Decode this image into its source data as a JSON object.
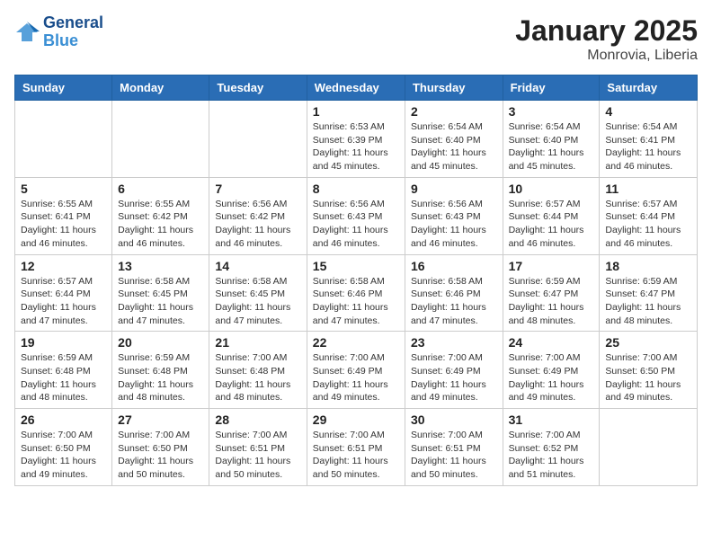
{
  "header": {
    "logo_line1": "General",
    "logo_line2": "Blue",
    "month": "January 2025",
    "location": "Monrovia, Liberia"
  },
  "days_of_week": [
    "Sunday",
    "Monday",
    "Tuesday",
    "Wednesday",
    "Thursday",
    "Friday",
    "Saturday"
  ],
  "weeks": [
    [
      {
        "day": "",
        "info": ""
      },
      {
        "day": "",
        "info": ""
      },
      {
        "day": "",
        "info": ""
      },
      {
        "day": "1",
        "info": "Sunrise: 6:53 AM\nSunset: 6:39 PM\nDaylight: 11 hours\nand 45 minutes."
      },
      {
        "day": "2",
        "info": "Sunrise: 6:54 AM\nSunset: 6:40 PM\nDaylight: 11 hours\nand 45 minutes."
      },
      {
        "day": "3",
        "info": "Sunrise: 6:54 AM\nSunset: 6:40 PM\nDaylight: 11 hours\nand 45 minutes."
      },
      {
        "day": "4",
        "info": "Sunrise: 6:54 AM\nSunset: 6:41 PM\nDaylight: 11 hours\nand 46 minutes."
      }
    ],
    [
      {
        "day": "5",
        "info": "Sunrise: 6:55 AM\nSunset: 6:41 PM\nDaylight: 11 hours\nand 46 minutes."
      },
      {
        "day": "6",
        "info": "Sunrise: 6:55 AM\nSunset: 6:42 PM\nDaylight: 11 hours\nand 46 minutes."
      },
      {
        "day": "7",
        "info": "Sunrise: 6:56 AM\nSunset: 6:42 PM\nDaylight: 11 hours\nand 46 minutes."
      },
      {
        "day": "8",
        "info": "Sunrise: 6:56 AM\nSunset: 6:43 PM\nDaylight: 11 hours\nand 46 minutes."
      },
      {
        "day": "9",
        "info": "Sunrise: 6:56 AM\nSunset: 6:43 PM\nDaylight: 11 hours\nand 46 minutes."
      },
      {
        "day": "10",
        "info": "Sunrise: 6:57 AM\nSunset: 6:44 PM\nDaylight: 11 hours\nand 46 minutes."
      },
      {
        "day": "11",
        "info": "Sunrise: 6:57 AM\nSunset: 6:44 PM\nDaylight: 11 hours\nand 46 minutes."
      }
    ],
    [
      {
        "day": "12",
        "info": "Sunrise: 6:57 AM\nSunset: 6:44 PM\nDaylight: 11 hours\nand 47 minutes."
      },
      {
        "day": "13",
        "info": "Sunrise: 6:58 AM\nSunset: 6:45 PM\nDaylight: 11 hours\nand 47 minutes."
      },
      {
        "day": "14",
        "info": "Sunrise: 6:58 AM\nSunset: 6:45 PM\nDaylight: 11 hours\nand 47 minutes."
      },
      {
        "day": "15",
        "info": "Sunrise: 6:58 AM\nSunset: 6:46 PM\nDaylight: 11 hours\nand 47 minutes."
      },
      {
        "day": "16",
        "info": "Sunrise: 6:58 AM\nSunset: 6:46 PM\nDaylight: 11 hours\nand 47 minutes."
      },
      {
        "day": "17",
        "info": "Sunrise: 6:59 AM\nSunset: 6:47 PM\nDaylight: 11 hours\nand 48 minutes."
      },
      {
        "day": "18",
        "info": "Sunrise: 6:59 AM\nSunset: 6:47 PM\nDaylight: 11 hours\nand 48 minutes."
      }
    ],
    [
      {
        "day": "19",
        "info": "Sunrise: 6:59 AM\nSunset: 6:48 PM\nDaylight: 11 hours\nand 48 minutes."
      },
      {
        "day": "20",
        "info": "Sunrise: 6:59 AM\nSunset: 6:48 PM\nDaylight: 11 hours\nand 48 minutes."
      },
      {
        "day": "21",
        "info": "Sunrise: 7:00 AM\nSunset: 6:48 PM\nDaylight: 11 hours\nand 48 minutes."
      },
      {
        "day": "22",
        "info": "Sunrise: 7:00 AM\nSunset: 6:49 PM\nDaylight: 11 hours\nand 49 minutes."
      },
      {
        "day": "23",
        "info": "Sunrise: 7:00 AM\nSunset: 6:49 PM\nDaylight: 11 hours\nand 49 minutes."
      },
      {
        "day": "24",
        "info": "Sunrise: 7:00 AM\nSunset: 6:49 PM\nDaylight: 11 hours\nand 49 minutes."
      },
      {
        "day": "25",
        "info": "Sunrise: 7:00 AM\nSunset: 6:50 PM\nDaylight: 11 hours\nand 49 minutes."
      }
    ],
    [
      {
        "day": "26",
        "info": "Sunrise: 7:00 AM\nSunset: 6:50 PM\nDaylight: 11 hours\nand 49 minutes."
      },
      {
        "day": "27",
        "info": "Sunrise: 7:00 AM\nSunset: 6:50 PM\nDaylight: 11 hours\nand 50 minutes."
      },
      {
        "day": "28",
        "info": "Sunrise: 7:00 AM\nSunset: 6:51 PM\nDaylight: 11 hours\nand 50 minutes."
      },
      {
        "day": "29",
        "info": "Sunrise: 7:00 AM\nSunset: 6:51 PM\nDaylight: 11 hours\nand 50 minutes."
      },
      {
        "day": "30",
        "info": "Sunrise: 7:00 AM\nSunset: 6:51 PM\nDaylight: 11 hours\nand 50 minutes."
      },
      {
        "day": "31",
        "info": "Sunrise: 7:00 AM\nSunset: 6:52 PM\nDaylight: 11 hours\nand 51 minutes."
      },
      {
        "day": "",
        "info": ""
      }
    ]
  ]
}
